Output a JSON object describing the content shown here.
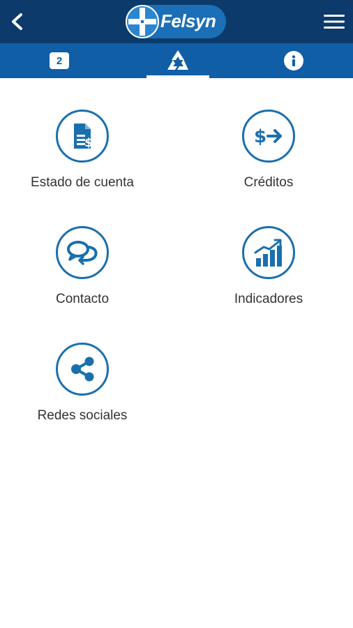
{
  "header": {
    "logo_text": "Felsyn",
    "back_icon": "chevron-left-icon",
    "menu_icon": "hamburger-menu-icon",
    "background_color": "#0b3a6b"
  },
  "tabs": [
    {
      "badge": "2",
      "icon": "notification-badge-icon"
    },
    {
      "icon": "recycle-logo-icon",
      "active": true
    },
    {
      "icon": "info-icon"
    }
  ],
  "tabbar_color": "#0f5ea6",
  "accent_color": "#1a6fae",
  "menu": {
    "items": [
      {
        "label": "Estado de cuenta",
        "icon": "account-statement-icon"
      },
      {
        "label": "Créditos",
        "icon": "credit-transfer-icon"
      },
      {
        "label": "Contacto",
        "icon": "chat-bubbles-icon"
      },
      {
        "label": "Indicadores",
        "icon": "bar-chart-icon"
      },
      {
        "label": "Redes sociales",
        "icon": "share-icon"
      }
    ]
  }
}
